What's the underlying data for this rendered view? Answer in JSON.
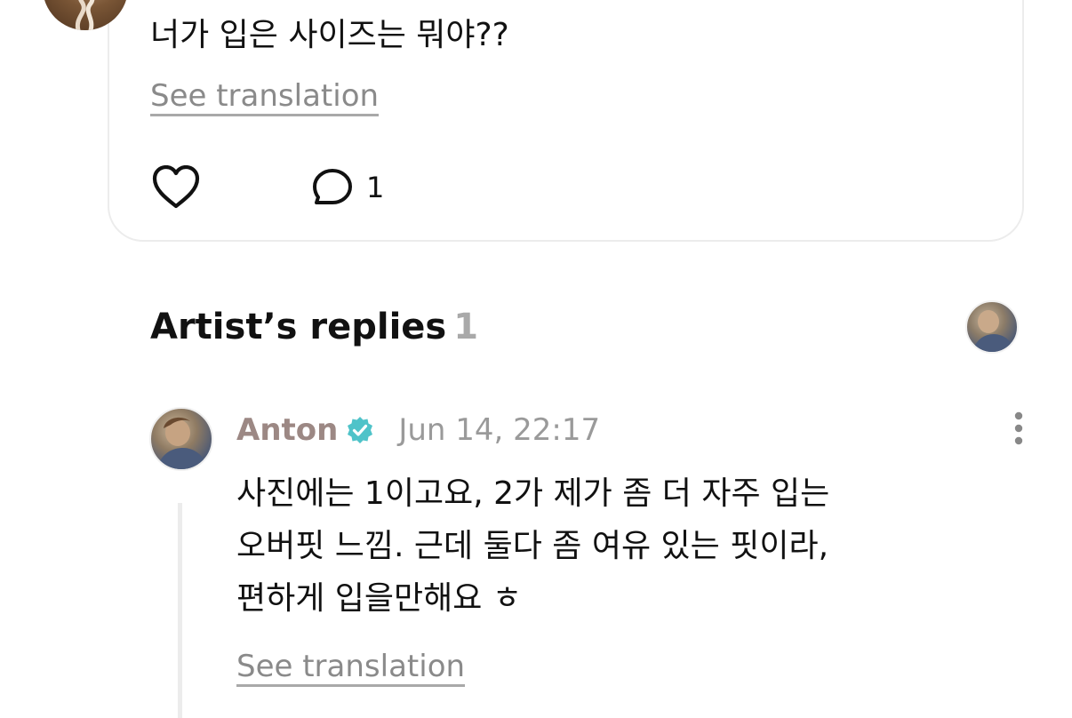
{
  "post": {
    "text": "너가 입은 사이즈는 뭐야??",
    "see_translation": "See translation",
    "comment_count": "1",
    "icons": {
      "like": "heart-outline-icon",
      "comment": "speech-bubble-icon"
    }
  },
  "replies_section": {
    "title": "Artist’s replies",
    "count": "1"
  },
  "reply": {
    "author": "Anton",
    "timestamp": "Jun 14, 22:17",
    "lines": [
      "사진에는 1이고요, 2가 제가 좀 더 자주 입는",
      "오버핏 느낌. 근데 둘다 좀 여유 있는 핏이라,",
      "편하게 입을만해요 ㅎ"
    ],
    "see_translation": "See translation",
    "icons": {
      "verified": "verified-badge-icon",
      "more": "more-vertical-icon"
    }
  },
  "colors": {
    "author": "#9c8884",
    "verified": "#4fc3c9",
    "muted": "#9a9a9a",
    "card_border": "#ececec"
  }
}
